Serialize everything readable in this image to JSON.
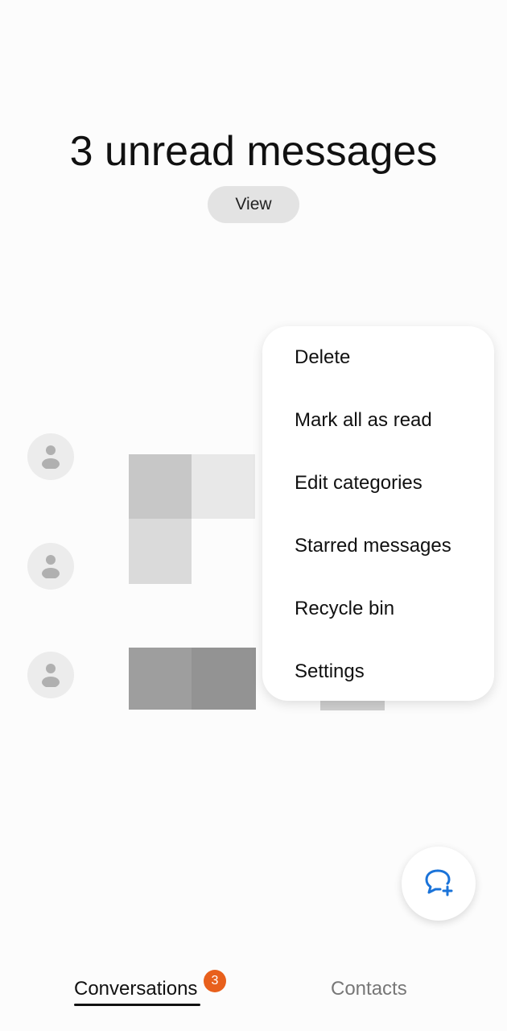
{
  "header": {
    "title": "3 unread messages",
    "view_label": "View"
  },
  "menu": {
    "items": [
      "Delete",
      "Mark all as read",
      "Edit categories",
      "Starred messages",
      "Recycle bin",
      "Settings"
    ]
  },
  "fab": {
    "icon": "new-message-icon",
    "color": "#1a73d9"
  },
  "tabs": {
    "conversations": "Conversations",
    "conversations_badge": "3",
    "contacts": "Contacts",
    "badge_color": "#e8601c"
  }
}
